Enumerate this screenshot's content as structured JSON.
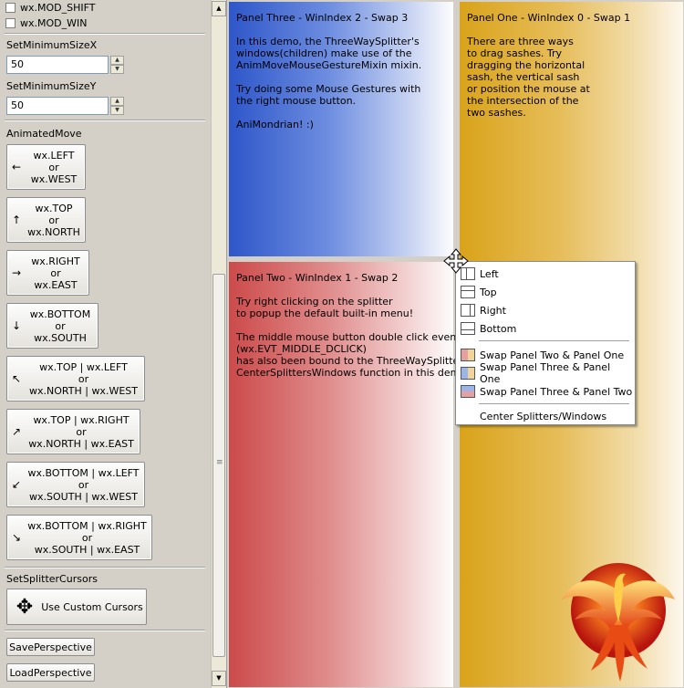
{
  "left_panel": {
    "modifiers": [
      {
        "label": "wx.MOD_SHIFT",
        "checked": false
      },
      {
        "label": "wx.MOD_WIN",
        "checked": false
      }
    ],
    "min_size_x": {
      "label": "SetMinimumSizeX",
      "value": "50"
    },
    "min_size_y": {
      "label": "SetMinimumSizeY",
      "value": "50"
    },
    "animated_move": {
      "label": "AnimatedMove",
      "buttons": [
        {
          "l1": "wx.LEFT",
          "l2": "or",
          "l3": "wx.WEST",
          "icon": "←"
        },
        {
          "l1": "wx.TOP",
          "l2": "or",
          "l3": "wx.NORTH",
          "icon": "↑"
        },
        {
          "l1": "wx.RIGHT",
          "l2": "or",
          "l3": "wx.EAST",
          "icon": "→"
        },
        {
          "l1": "wx.BOTTOM",
          "l2": "or",
          "l3": "wx.SOUTH",
          "icon": "↓"
        },
        {
          "l1": "wx.TOP | wx.LEFT",
          "l2": "or",
          "l3": "wx.NORTH | wx.WEST",
          "icon": "↖"
        },
        {
          "l1": "wx.TOP | wx.RIGHT",
          "l2": "or",
          "l3": "wx.NORTH | wx.EAST",
          "icon": "↗"
        },
        {
          "l1": "wx.BOTTOM | wx.LEFT",
          "l2": "or",
          "l3": "wx.SOUTH | wx.WEST",
          "icon": "↙"
        },
        {
          "l1": "wx.BOTTOM | wx.RIGHT",
          "l2": "or",
          "l3": "wx.SOUTH | wx.EAST",
          "icon": "↘"
        }
      ]
    },
    "splitter_cursors": {
      "label": "SetSplitterCursors",
      "button": "Use Custom Cursors"
    },
    "save_perspective": "SavePerspective",
    "load_perspective": "LoadPerspective"
  },
  "panels": {
    "three": {
      "title": "Panel Three - WinIndex 2 - Swap 3",
      "p1": [
        "In this demo, the ThreeWaySplitter's",
        "windows(children) make use of the",
        "AnimMoveMouseGestureMixin mixin."
      ],
      "p2": [
        "Try doing some Mouse Gestures with",
        "the right mouse button."
      ],
      "p3": [
        "AniMondrian! :)"
      ]
    },
    "one": {
      "title": "Panel One - WinIndex 0 - Swap 1",
      "p1": [
        "There are three ways",
        "to drag sashes. Try",
        "dragging the horizontal",
        "sash, the vertical sash",
        "or position the mouse at",
        "the intersection of the",
        "two sashes."
      ]
    },
    "two": {
      "title": "Panel Two - WinIndex 1 - Swap 2",
      "p1": [
        "Try right clicking on the splitter",
        "to popup the default built-in menu!"
      ],
      "p2": [
        "The middle mouse button double click event",
        "(wx.EVT_MIDDLE_DCLICK)",
        "has also been bound to the ThreeWaySplitter's",
        "CenterSplittersWindows function in this demo."
      ]
    }
  },
  "context_menu": {
    "items": [
      "Left",
      "Top",
      "Right",
      "Bottom"
    ],
    "swap_items": [
      "Swap Panel Two & Panel One",
      "Swap Panel Three & Panel One",
      "Swap Panel Three & Panel Two"
    ],
    "center": "Center Splitters/Windows"
  },
  "colors": {
    "panel_three": "#2e56c9",
    "panel_one": "#d9a31a",
    "panel_two": "#cc4a4a"
  }
}
